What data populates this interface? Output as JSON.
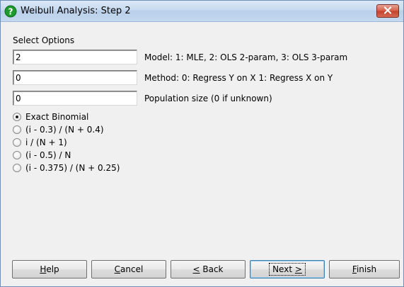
{
  "window": {
    "title": "Weibull Analysis: Step 2",
    "title_icon": "help-question-icon",
    "close_icon": "close-icon"
  },
  "section_label": "Select Options",
  "fields": [
    {
      "value": "2",
      "label": "Model: 1: MLE, 2: OLS 2-param, 3: OLS 3-param"
    },
    {
      "value": "0",
      "label": "Method: 0: Regress Y on X 1: Regress X on Y"
    },
    {
      "value": "0",
      "label": "Population size (0 if unknown)"
    }
  ],
  "radio_options": [
    {
      "label": "Exact Binomial",
      "checked": true
    },
    {
      "label": "(i - 0.3) / (N + 0.4)",
      "checked": false
    },
    {
      "label": "i / (N + 1)",
      "checked": false
    },
    {
      "label": "(i - 0.5) / N",
      "checked": false
    },
    {
      "label": "(i - 0.375) / (N + 0.25)",
      "checked": false
    }
  ],
  "buttons": {
    "help": {
      "mnemonic": "H",
      "rest": "elp"
    },
    "cancel": {
      "mnemonic": "C",
      "rest": "ancel"
    },
    "back": {
      "mnemonic": "<",
      "rest": " Back"
    },
    "next": {
      "pre": "Next ",
      "mnemonic": ">"
    },
    "finish": {
      "mnemonic": "F",
      "rest": "inish"
    }
  },
  "colors": {
    "window_bg": "#f0f0f0",
    "titlebar": "#c7daf0",
    "close_button": "#c3432d",
    "help_icon": "#1f9a2e"
  }
}
